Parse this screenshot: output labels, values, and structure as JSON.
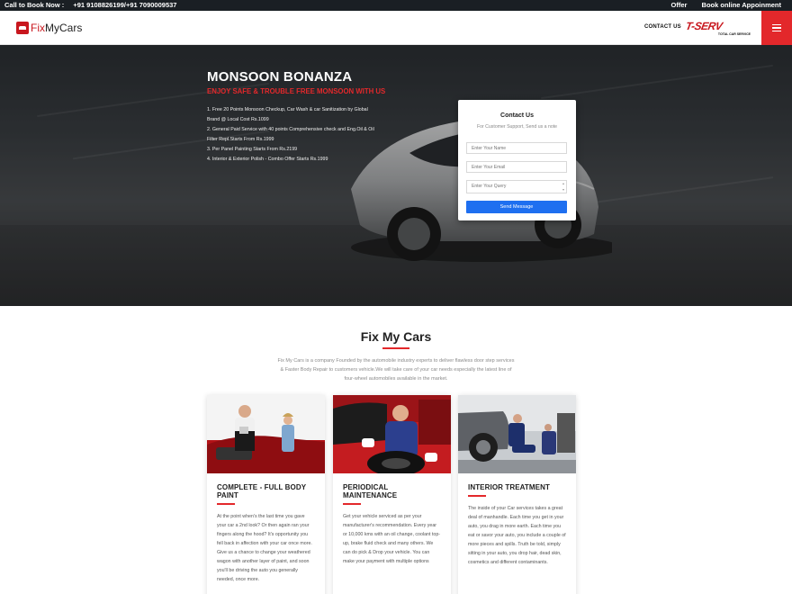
{
  "topbar": {
    "call_label": "Call to Book Now :",
    "phones": "+91 9108826199/+91 7090009537",
    "offer": "Offer",
    "book": "Book online Appoinment"
  },
  "header": {
    "logo_part1": "Fix",
    "logo_part2": "MyCars",
    "contact_link": "CONTACT US",
    "partner_logo": "T-SERV",
    "partner_tagline": "TOTAL CAR SERVICE",
    "menu_icon": "hamburger-icon"
  },
  "hero": {
    "title": "MONSOON BONANZA",
    "subtitle": "ENJOY SAFE & TROUBLE FREE MONSOON WITH US",
    "offers": [
      "1. Free 20 Points Monsoon Checkup, Car Wash & car Sanitization by Global Brand @ Local Cost Rs.1099",
      "2. General Paid Service with 40 points Comprehensive check and Eng.Oil & Oil Filter Repl.Starts From Rs.1999",
      "3. Per Panel Painting Starts From Rs.2199",
      "4. Interior & Exterior Polish - Combo Offer Starts Rs.1999"
    ]
  },
  "contact_form": {
    "title": "Contact Us",
    "note": "For Customer Support, Send us a note",
    "name_placeholder": "Enter Your Name",
    "email_placeholder": "Enter Your Email",
    "query_placeholder": "Enter Your Query",
    "submit_label": "Send Message",
    "button_color": "#1e6ff0"
  },
  "about": {
    "title": "Fix My Cars",
    "description": "Fix My Cars is a company Founded by the automobile industry experts to deliver flawless door step services & Faster Body Repair to customers vehicle.We will take care of your car needs especially the latest line of four-wheel automobiles available in the market."
  },
  "services": [
    {
      "title": "COMPLETE - FULL BODY PAINT",
      "text": "At the point when's the last time you gave your car a 2nd look? Or then again ran your fingers along the hood? It's opportunity you fell back in affection with your car once more. Give us a chance to change your weathered wagon with another layer of paint, and soon you'll be driving the auto you generally needed, once more."
    },
    {
      "title": "PERIODICAL MAINTENANCE",
      "text": "Get your vehicle serviced as per your manufacturer's recommendation. Every year or 10,000 kms with an oil change, coolant top-up, brake fluid check and many others. We can do pick & Drop your vehicle. You can make your payment with multiple options"
    },
    {
      "title": "INTERIOR TREATMENT",
      "text": "The inside of your Car services takes a great deal of manhandle. Each time you get in your auto, you drag in more earth. Each time you eat or savor your auto, you include a couple of more pieces and spills. Truth be told, simply sitting in your auto, you drop hair, dead skin, cosmetics and different contaminants."
    }
  ],
  "colors": {
    "accent": "#e3282b",
    "topbar": "#1a1f24"
  }
}
